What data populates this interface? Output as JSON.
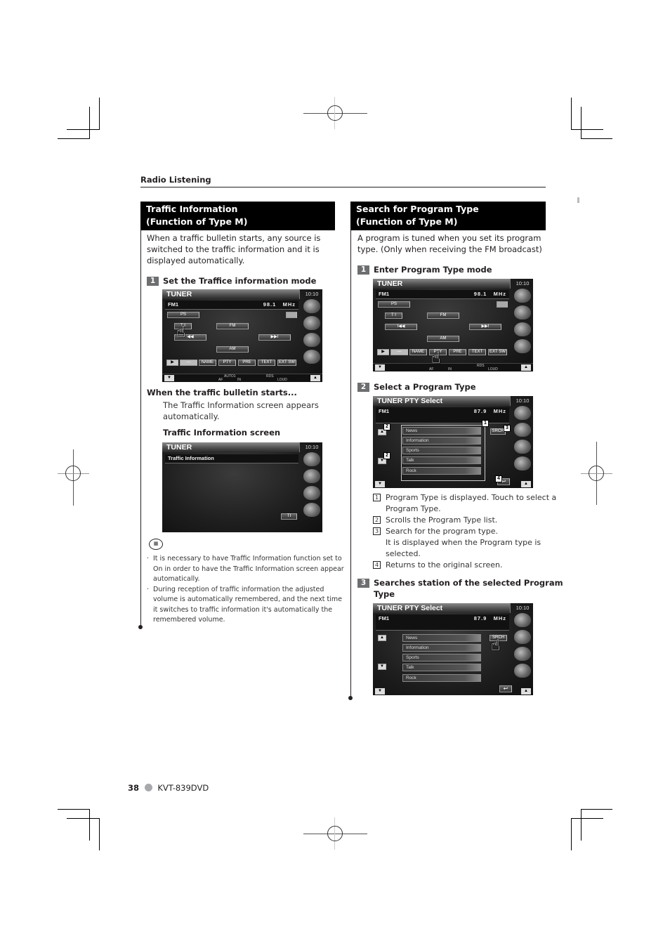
{
  "header": {
    "section_label": "Radio Listening"
  },
  "left": {
    "heading_line1": "Traffic Information",
    "heading_line2": "(Function of Type M)",
    "intro": [
      "When a traffic bulletin starts, any source is",
      "switched to the traffic information and it is",
      "displayed automatically."
    ],
    "step1": {
      "num": "1",
      "label": "Set the Traffice information mode"
    },
    "screen1": {
      "title": "TUNER",
      "clock": "10:10",
      "band": "FM1",
      "freq": "98.1",
      "unit": "MHz",
      "ps_button": "PS",
      "ti_button": "T I",
      "fm_button": "FM",
      "prev_button": "◀◀",
      "next_button": "▶▶I",
      "am_button": "AM",
      "row_buttons": [
        "▶",
        "—",
        "NAME",
        "PTY",
        "PRE",
        "TEXT",
        "EXT SW"
      ],
      "status": {
        "auto": "AUTO1",
        "af": "AF",
        "in": "IN",
        "rds": "RDS",
        "loud": "LOUD"
      },
      "vol_down": "▼",
      "vol_up": "▲"
    },
    "when_heading": "When the traffic bulletin starts...",
    "when_text": [
      "The Traffic Information screen appears",
      "automatically."
    ],
    "screen_caption": "Traffic Information screen",
    "screen2": {
      "title": "TUNER",
      "clock": "10:10",
      "banner": "Traffic Information",
      "ti_button": "TI"
    },
    "notes": [
      [
        "It is necessary to have Traffic Information function set to",
        "On in order to have the Traffic Information screen appear",
        "automatically."
      ],
      [
        "During reception of traffic information the adjusted",
        "volume is automatically remembered, and the next time",
        "it switches to traffic information it's automatically the",
        "remembered volume."
      ]
    ]
  },
  "right": {
    "heading_line1": "Search for Program Type",
    "heading_line2": "(Function of Type M)",
    "intro": [
      "A program is tuned when you set its program",
      "type. (Only when receiving the FM broadcast)"
    ],
    "step1": {
      "num": "1",
      "label": "Enter Program Type mode"
    },
    "screen1": {
      "title": "TUNER",
      "clock": "10:10",
      "band": "FM1",
      "freq": "98.1",
      "unit": "MHz",
      "ps_button": "PS",
      "ti_button": "T I",
      "fm_button": "FM",
      "prev_button": "I◀◀",
      "next_button": "▶▶I",
      "am_button": "AM",
      "row_buttons": [
        "▶",
        "—",
        "NAME",
        "PTY",
        "PRE",
        "TEXT",
        "EXT SW"
      ],
      "status": {
        "af": "AF",
        "in": "IN",
        "rds": "RDS",
        "loud": "LOUD"
      },
      "vol_down": "▼",
      "vol_up": "▲"
    },
    "step2": {
      "num": "2",
      "label": "Select a Program Type"
    },
    "screen2": {
      "title": "TUNER PTY Select",
      "clock": "10:10",
      "band": "FM1",
      "freq": "87.9",
      "unit": "MHz",
      "items": [
        "News",
        "Information",
        "Sports",
        "Talk",
        "Rock"
      ],
      "search_button": "SRCH",
      "return_icon": "↩",
      "up": "▲",
      "down": "▼",
      "callouts": [
        "1",
        "2",
        "2",
        "3",
        "4"
      ]
    },
    "legend": [
      {
        "n": "1",
        "lines": [
          "Program Type is displayed. Touch to select a",
          "Program Type."
        ]
      },
      {
        "n": "2",
        "lines": [
          "Scrolls the Program Type list."
        ]
      },
      {
        "n": "3",
        "lines": [
          "Search for the program type.",
          "It is displayed when the Program type is",
          "selected."
        ]
      },
      {
        "n": "4",
        "lines": [
          "Returns to the original screen."
        ]
      }
    ],
    "step3": {
      "num": "3",
      "label_line1": "Searches station of the selected Program",
      "label_line2": "Type"
    },
    "screen3": {
      "title": "TUNER PTY Select",
      "clock": "10:10",
      "band": "FM1",
      "freq": "87.9",
      "unit": "MHz",
      "items": [
        "News",
        "Information",
        "Sports",
        "Talk",
        "Rock"
      ],
      "search_button": "SRCH",
      "return_icon": "↩",
      "up": "▲",
      "down": "▼"
    }
  },
  "footer": {
    "page": "38",
    "model": "KVT-839DVD"
  }
}
